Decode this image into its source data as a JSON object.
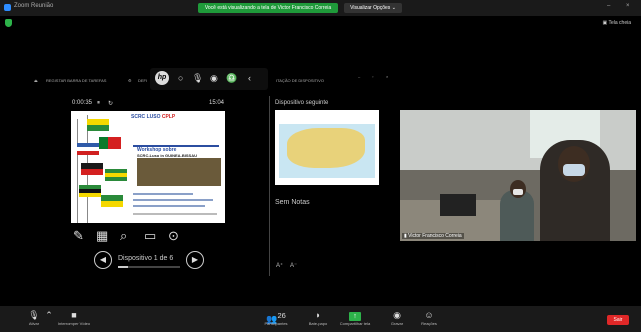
{
  "window": {
    "title": "Zoom Reunião",
    "minimize": "–",
    "close": "×"
  },
  "banner": {
    "text": "Você está visualizando a tela de Victor Francisco Correia",
    "view_options": "Visualizar Opções ⌄"
  },
  "top_right": {
    "fullscreen": "▣ Tela cheia"
  },
  "presenter_toolbar": {
    "left_item": "REGISTAR BARRA DE TAREFAS",
    "mid_item": "DEFI",
    "right_item": "ITAÇÃO DE DISPOSITIVO",
    "minus": "–",
    "restore": "▫",
    "close": "×"
  },
  "presenter": {
    "timer": "0:00:35",
    "clock": "15:04",
    "next_label": "Dispositivo seguinte",
    "notes": "Sem Notas",
    "slide_counter": "Dispositivo 1 de 6",
    "progress": 0.167
  },
  "current_slide": {
    "header_line1": "SCRC",
    "header_line2": "LUSO",
    "header_line3": "CPLP",
    "subtitle": "Workshop sobre",
    "bottom_text": "SCRC-Luso in GUINEA-BISSAU"
  },
  "next_slide": {
    "title": "Mapa"
  },
  "video": {
    "name": "Victor Francisco Correia"
  },
  "bottom_controls": {
    "audio": "Ativar",
    "video": "Interromper Vídeo",
    "participants": "Participantes",
    "participants_count": "26",
    "chat": "Bate-papo",
    "share": "Compartilhar tela",
    "record": "Gravar",
    "reactions": "Reações",
    "end": "Sair"
  },
  "colors": {
    "share_green": "#2db34a",
    "end_red": "#e02828",
    "banner_green": "#1f9a3a"
  }
}
